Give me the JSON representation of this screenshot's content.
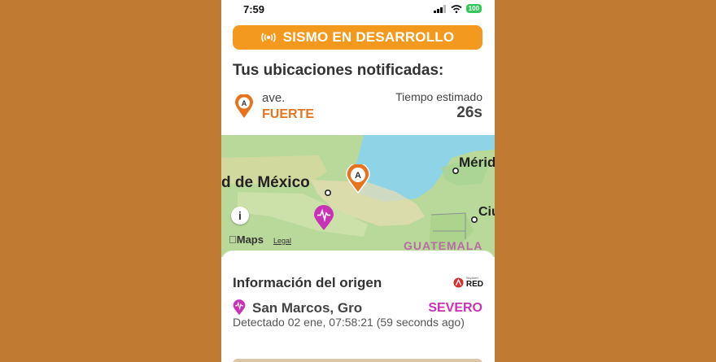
{
  "status": {
    "time": "7:59",
    "battery": "100"
  },
  "banner": {
    "label": "SISMO EN DESARROLLO",
    "icon": "broadcast-icon",
    "color": "#f39a1e"
  },
  "locations": {
    "title": "Tus ubicaciones notificadas:",
    "items": [
      {
        "marker": "A",
        "name": "ave.",
        "intensity": "FUERTE",
        "intensity_color": "#e8731e",
        "eta_label": "Tiempo estimado",
        "eta_value": "26s"
      }
    ]
  },
  "map": {
    "labels": {
      "city_left": "d de México",
      "city_right": "Mérid",
      "city_bottom_right": "Ciu",
      "country": "GUATEMALA"
    },
    "marker_a": "A",
    "attribution": {
      "brand": "Maps",
      "legal": "Legal"
    },
    "info_button": "i"
  },
  "origin": {
    "title": "Información del origen",
    "brand": {
      "sub": "SkyAlert",
      "name": "RED"
    },
    "place": "San Marcos, Gro",
    "severity": "SEVERO",
    "severity_color": "#c832b4",
    "detected": "Detectado 02 ene, 07:58:21 (59 seconds ago)"
  }
}
